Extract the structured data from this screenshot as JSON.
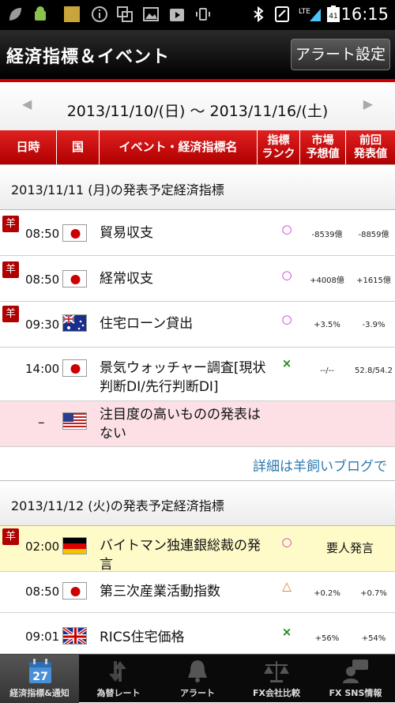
{
  "statusbar": {
    "time": "16:15",
    "battery": "41"
  },
  "titlebar": {
    "title": "経済指標＆イベント",
    "alert_button": "アラート設定"
  },
  "datenav": {
    "range": "2013/11/10/(日) 〜 2013/11/16/(土)",
    "prev": "◀",
    "next": "▶"
  },
  "table_header": {
    "time": "日時",
    "country": "国",
    "event": "イベント・経済指標名",
    "rank": "指標ランク",
    "forecast": "市場予想値",
    "previous": "前回発表値",
    "rank_lines": [
      "指標",
      "ランク"
    ],
    "forecast_lines": [
      "市場",
      "予想値"
    ],
    "previous_lines": [
      "前回",
      "発表値"
    ]
  },
  "sections": [
    {
      "heading": "2013/11/11 (月)の発表予定経済指標",
      "rows": [
        {
          "badge": "羊",
          "time": "08:50",
          "country": "jp",
          "name": "貿易収支",
          "rank": "○",
          "forecast": "-8539億",
          "previous": "-8859億"
        },
        {
          "badge": "羊",
          "time": "08:50",
          "country": "jp",
          "name": "経常収支",
          "rank": "○",
          "forecast": "+4008億",
          "previous": "+1615億"
        },
        {
          "badge": "羊",
          "time": "09:30",
          "country": "au",
          "name": "住宅ローン貸出",
          "rank": "○",
          "forecast": "+3.5%",
          "previous": "-3.9%"
        },
        {
          "badge": "",
          "time": "14:00",
          "country": "jp",
          "name": "景気ウォッチャー調査[現状判断DI/先行判断DI]",
          "rank": "×",
          "forecast": "--/--",
          "previous": "52.8/54.2"
        }
      ],
      "notice": {
        "dash": "–",
        "country": "us",
        "text": "注目度の高いものの発表はない"
      },
      "more_link": "詳細は羊飼いブログで"
    },
    {
      "heading": "2013/11/12 (火)の発表予定経済指標",
      "rows": [
        {
          "badge": "羊",
          "time": "02:00",
          "country": "de",
          "name": "バイトマン独連銀総裁の発言",
          "rank": "○",
          "forecast": "要人発言",
          "previous": ""
        },
        {
          "badge": "",
          "time": "08:50",
          "country": "jp",
          "name": "第三次産業活動指数",
          "rank": "△",
          "forecast": "+0.2%",
          "previous": "+0.7%"
        },
        {
          "badge": "",
          "time": "09:01",
          "country": "gb",
          "name": "RICS住宅価格",
          "rank": "×",
          "forecast": "+56%",
          "previous": "+54%"
        }
      ]
    }
  ],
  "tabs": [
    {
      "label": "経済指標&通知",
      "icon": "calendar-icon",
      "active": true,
      "day": "27"
    },
    {
      "label": "為替レート",
      "icon": "exchange-arrows-icon",
      "active": false
    },
    {
      "label": "アラート",
      "icon": "bell-icon",
      "active": false
    },
    {
      "label": "FX会社比較",
      "icon": "scales-icon",
      "active": false
    },
    {
      "label": "FX SNS情報",
      "icon": "chat-person-icon",
      "active": false
    }
  ],
  "colors": {
    "accent_red": "#c00000",
    "rank_circle": "#cc33cc",
    "rank_cross": "#1a8a1a",
    "rank_triangle": "#e07a20",
    "link_blue": "#2a7ab0"
  }
}
